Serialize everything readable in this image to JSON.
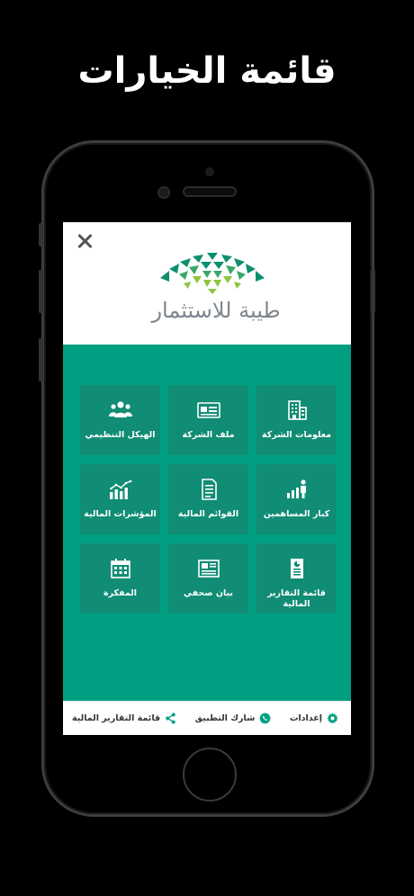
{
  "promo": {
    "title": "قائمة الخيارات"
  },
  "app": {
    "logo_text": "طيبة للاستثمار",
    "colors": {
      "primary": "#009f82",
      "tile": "#108d74",
      "logo_green_dark": "#0d8f6e",
      "logo_green_light": "#8cc63f",
      "logo_text": "#7d8791"
    }
  },
  "menu": {
    "tiles": [
      {
        "label": "معلومات الشركة",
        "icon": "building-icon"
      },
      {
        "label": "ملف الشركة",
        "icon": "id-card-icon"
      },
      {
        "label": "الهيكل التنظيمي",
        "icon": "people-group-icon"
      },
      {
        "label": "كبار المساهمين",
        "icon": "person-chart-icon"
      },
      {
        "label": "القوائم المالية",
        "icon": "document-icon"
      },
      {
        "label": "المؤشرات المالية",
        "icon": "bar-chart-icon"
      },
      {
        "label": "قائمة التقارير المالية",
        "icon": "report-icon"
      },
      {
        "label": "بيان صحفي",
        "icon": "newspaper-icon"
      },
      {
        "label": "المفكرة",
        "icon": "calendar-icon"
      }
    ]
  },
  "footer": {
    "settings_label": "إعدادات",
    "share_app_label": "شارك التطبيق",
    "reports_list_label": "قائمة التقارير المالية"
  }
}
